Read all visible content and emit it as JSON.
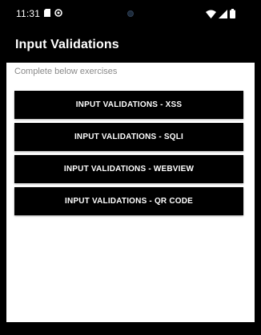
{
  "status_bar": {
    "time": "11:31",
    "left_icons": [
      "sd-card-icon",
      "sync-icon"
    ],
    "right_icons": [
      "wifi-icon",
      "signal-icon",
      "battery-icon"
    ]
  },
  "app_bar": {
    "title": "Input Validations"
  },
  "content": {
    "subtitle": "Complete below exercises",
    "buttons": [
      {
        "label": "INPUT VALIDATIONS - XSS"
      },
      {
        "label": "INPUT VALIDATIONS - SQLI"
      },
      {
        "label": "INPUT VALIDATIONS - WEBVIEW"
      },
      {
        "label": "INPUT VALIDATIONS - QR CODE"
      }
    ]
  },
  "colors": {
    "background": "#000000",
    "surface": "#ffffff",
    "button": "#000000",
    "button_text": "#ffffff",
    "subtitle_text": "#8a8a8a"
  }
}
